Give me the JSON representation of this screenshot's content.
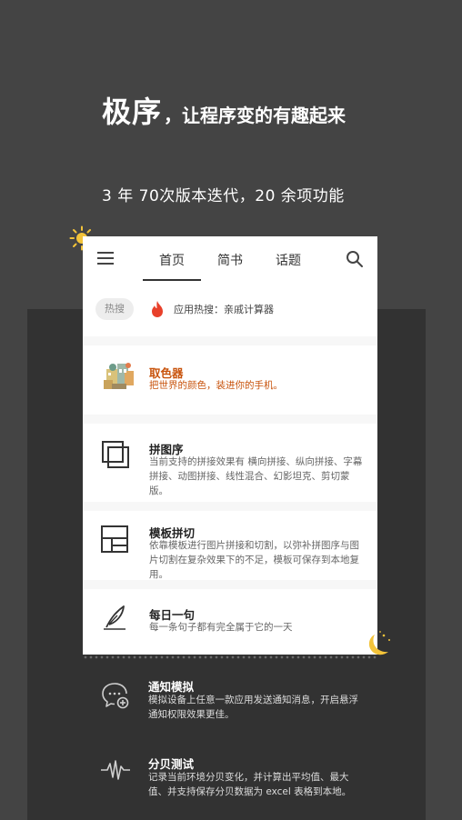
{
  "hero": {
    "brand": "极序",
    "tagline": "，让程序变的有趣起来",
    "subline": "3 年 70次版本迭代，20 余项功能"
  },
  "appbar": {
    "menu_icon": "hamburger-menu-icon",
    "tabs": [
      {
        "label": "首页",
        "active": true
      },
      {
        "label": "简书",
        "active": false
      },
      {
        "label": "话题",
        "active": false
      }
    ],
    "search_icon": "search-icon"
  },
  "hot": {
    "chip_label": "热搜",
    "text": "应用热搜：亲戚计算器"
  },
  "features": [
    {
      "title": "取色器",
      "desc": "把世界的颜色，装进你的手机。",
      "icon": "color-picker-illustration-icon",
      "accent": "#c8530c"
    },
    {
      "title": "拼图序",
      "desc": "当前支持的拼接效果有 横向拼接、纵向拼接、字幕拼接、动图拼接、线性混合、幻影坦克、剪切蒙版。",
      "icon": "stacked-squares-icon"
    },
    {
      "title": "模板拼切",
      "desc": "依靠模板进行图片拼接和切割，以弥补拼图序与图片切割在复杂效果下的不足，模板可保存到本地复用。",
      "icon": "layout-template-icon"
    },
    {
      "title": "每日一句",
      "desc": "每一条句子都有完全属于它的一天",
      "icon": "quill-pen-icon"
    }
  ],
  "dark_features": [
    {
      "title": "通知模拟",
      "desc": "模拟设备上任意一款应用发送通知消息，开启悬浮通知权限效果更佳。",
      "icon": "chat-bubble-add-icon"
    },
    {
      "title": "分贝测试",
      "desc": "记录当前环境分贝变化，并计算出平均值、最大值、并支持保存分贝数据为 excel 表格到本地。",
      "icon": "sound-wave-icon"
    }
  ],
  "decor": {
    "sun": "sun-icon",
    "moon": "moon-stars-icon"
  },
  "colors": {
    "background": "#444444",
    "panel": "#323232",
    "accent": "#c8530c",
    "fire": "#e8402a"
  }
}
